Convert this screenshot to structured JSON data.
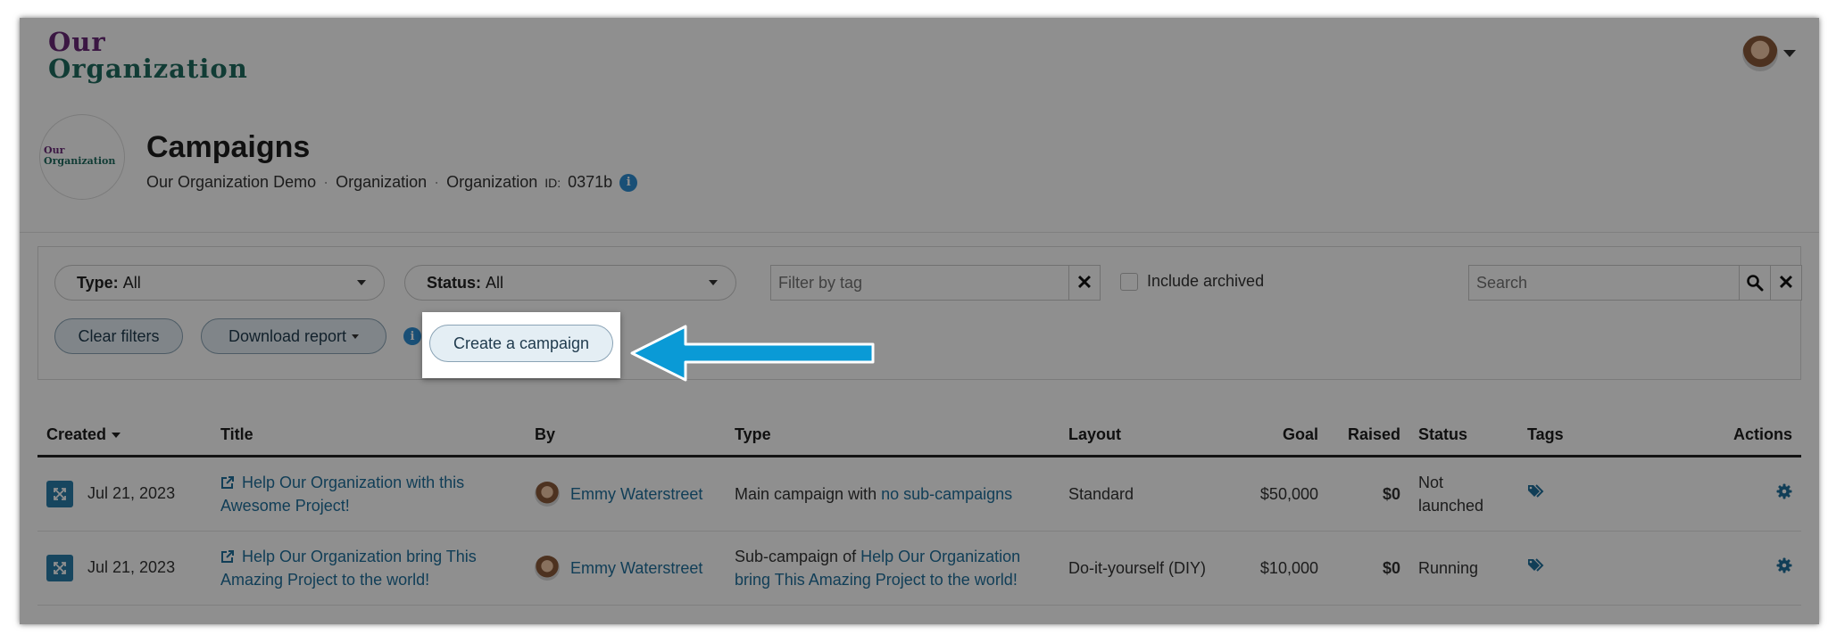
{
  "brand": {
    "line1": "Our",
    "line2": "Organization"
  },
  "header": {
    "title": "Campaigns",
    "org_logo_line1": "Our",
    "org_logo_line2": "Organization",
    "breadcrumb": {
      "item1": "Our Organization Demo",
      "item2": "Organization",
      "item3": "Organization",
      "id_label": "ID:",
      "id_value": "0371b",
      "info_glyph": "i"
    }
  },
  "filters": {
    "type_label": "Type:",
    "type_value": "All",
    "status_label": "Status:",
    "status_value": "All",
    "tag_placeholder": "Filter by tag",
    "include_archived": "Include archived",
    "search_placeholder": "Search",
    "clear_label": "Clear filters",
    "download_label": "Download report",
    "info_glyph": "i",
    "create_label": "Create a campaign"
  },
  "table": {
    "headers": {
      "created": "Created",
      "title": "Title",
      "by": "By",
      "type": "Type",
      "layout": "Layout",
      "goal": "Goal",
      "raised": "Raised",
      "status": "Status",
      "tags": "Tags",
      "actions": "Actions"
    },
    "rows": [
      {
        "date": "Jul 21, 2023",
        "title": "Help Our Organization with this Awesome Project!",
        "by": "Emmy Waterstreet",
        "type_text": "Main campaign with",
        "type_link": "no sub-campaigns",
        "layout": "Standard",
        "goal": "$50,000",
        "raised": "$0",
        "status": "Not launched"
      },
      {
        "date": "Jul 21, 2023",
        "title": "Help Our Organization bring This Amazing Project to the world!",
        "by": "Emmy Waterstreet",
        "type_text": "Sub-campaign of",
        "type_link": "Help Our Organization bring This Amazing Project to the world!",
        "layout": "Do-it-yourself (DIY)",
        "goal": "$10,000",
        "raised": "$0",
        "status": "Running"
      }
    ]
  },
  "colors": {
    "accent": "#1f6f9c",
    "arrow": "#0a9ad6",
    "brand_purple": "#6a2a78",
    "brand_green": "#1f6b5f"
  },
  "icons": [
    "user-avatar-icon",
    "chevron-down-icon",
    "info-icon",
    "close-icon",
    "search-icon",
    "expand-icon",
    "external-link-icon",
    "tag-icon",
    "gear-icon",
    "arrow-left-icon"
  ]
}
